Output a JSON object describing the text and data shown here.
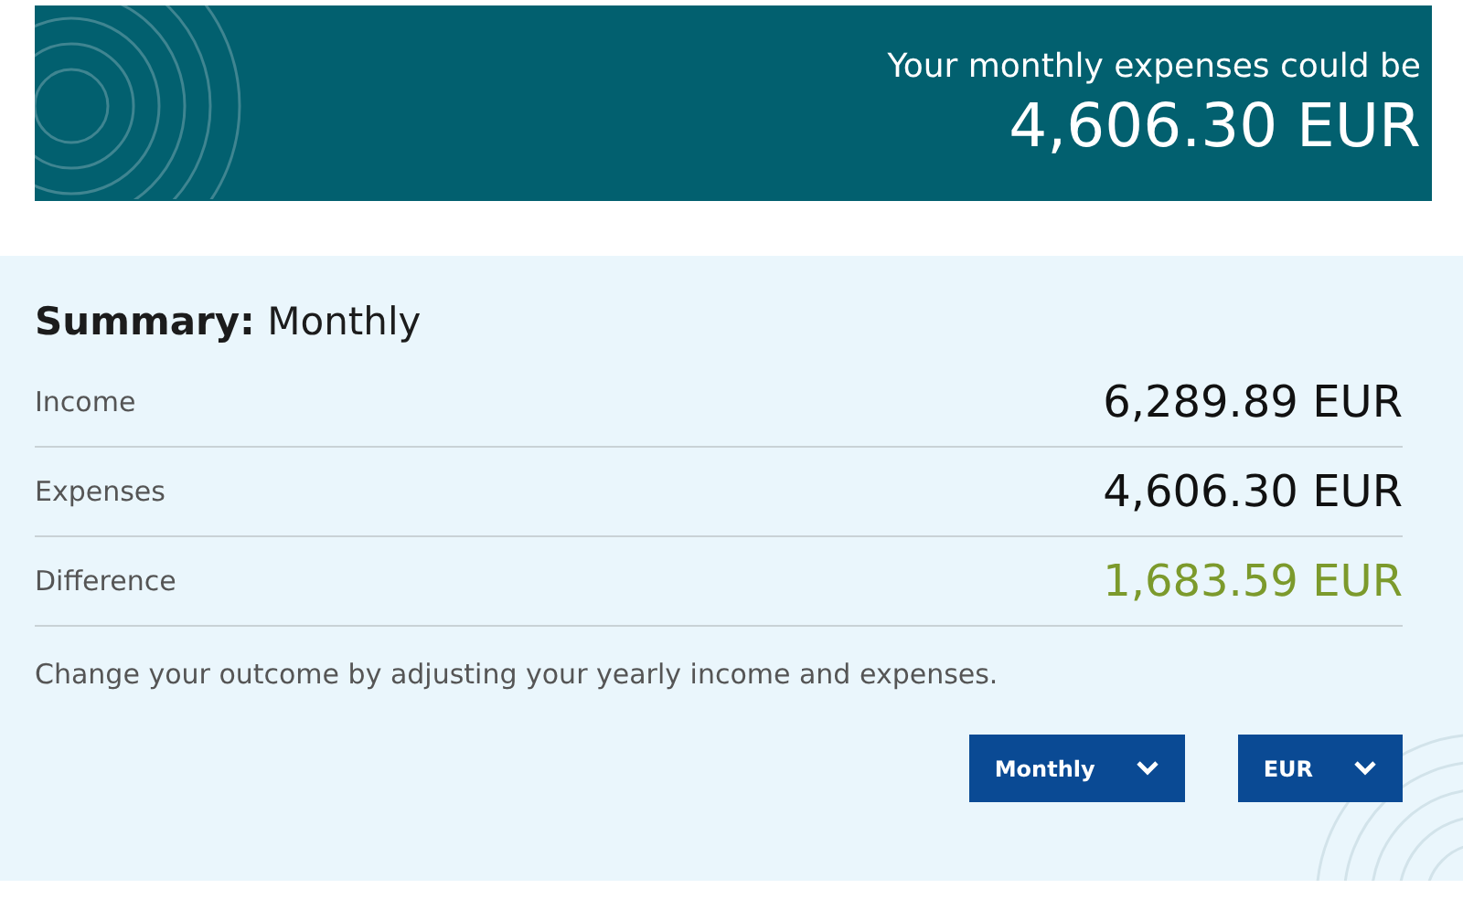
{
  "banner": {
    "caption": "Your monthly expenses could be",
    "amount": "4,606.30 EUR"
  },
  "summary": {
    "title": "**Summary:** Monthly",
    "rows": [
      {
        "label": "Income",
        "value": "6,289.89 EUR",
        "kind": "normal"
      },
      {
        "label": "Expenses",
        "value": "4,606.30 EUR",
        "kind": "normal"
      },
      {
        "label": "Difference",
        "value": "1,683.59 EUR",
        "kind": "positive"
      }
    ],
    "note": "Change your outcome by adjusting your yearly income and expenses.",
    "dropdowns": [
      {
        "value": "Monthly"
      },
      {
        "value": "EUR"
      }
    ]
  }
}
